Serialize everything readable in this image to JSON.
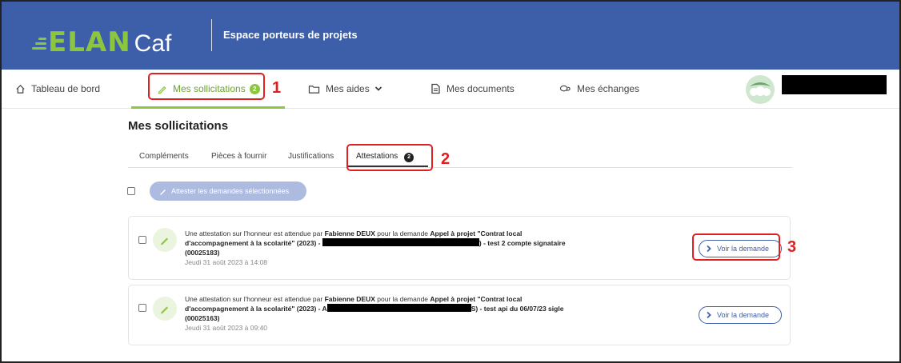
{
  "header": {
    "logo_main": "ELAN",
    "logo_sub": "Caf",
    "space_title": "Espace porteurs de projets"
  },
  "nav": {
    "items": [
      {
        "label": "Tableau de bord",
        "icon": "home-icon"
      },
      {
        "label": "Mes sollicitations",
        "icon": "pencil-icon",
        "badge": "2",
        "active": true
      },
      {
        "label": "Mes aides",
        "icon": "folder-icon",
        "dropdown": true
      },
      {
        "label": "Mes documents",
        "icon": "document-icon"
      },
      {
        "label": "Mes échanges",
        "icon": "chat-icon"
      }
    ]
  },
  "annotations": [
    "1",
    "2",
    "3"
  ],
  "main": {
    "title": "Mes sollicitations",
    "tabs": [
      {
        "label": "Compléments"
      },
      {
        "label": "Pièces à fournir"
      },
      {
        "label": "Justifications"
      },
      {
        "label": "Attestations",
        "badge": "2",
        "active": true
      }
    ],
    "bulk_action": "Attester les demandes sélectionnées",
    "requests": [
      {
        "text_prefix": "Une attestation sur l'honneur est attendue par ",
        "person": "Fabienne DEUX",
        "text_mid": " pour la demande ",
        "request_title_1": "Appel à projet \"Contrat local",
        "request_title_2": "d'accompagnement à la scolarité\" (2023) -",
        "request_tail": ") - test 2 compte signataire",
        "request_id": "(00025183)",
        "date": "Jeudi 31 août 2023 à 14:08",
        "action": "Voir la demande"
      },
      {
        "text_prefix": "Une attestation sur l'honneur est attendue par ",
        "person": "Fabienne DEUX",
        "text_mid": " pour la demande ",
        "request_title_1": "Appel à projet \"Contrat local",
        "request_title_2": "d'accompagnement à la scolarité\" (2023) - A",
        "request_tail": "S) - test api du 06/07/23 sigle",
        "request_id": "(00025163)",
        "date": "Jeudi 31 août 2023 à 09:40",
        "action": "Voir la demande"
      }
    ]
  },
  "colors": {
    "header_bg": "#3d5ea8",
    "accent_green": "#8cc63f",
    "annotation_red": "#e02020",
    "link_blue": "#3d5ea8"
  }
}
